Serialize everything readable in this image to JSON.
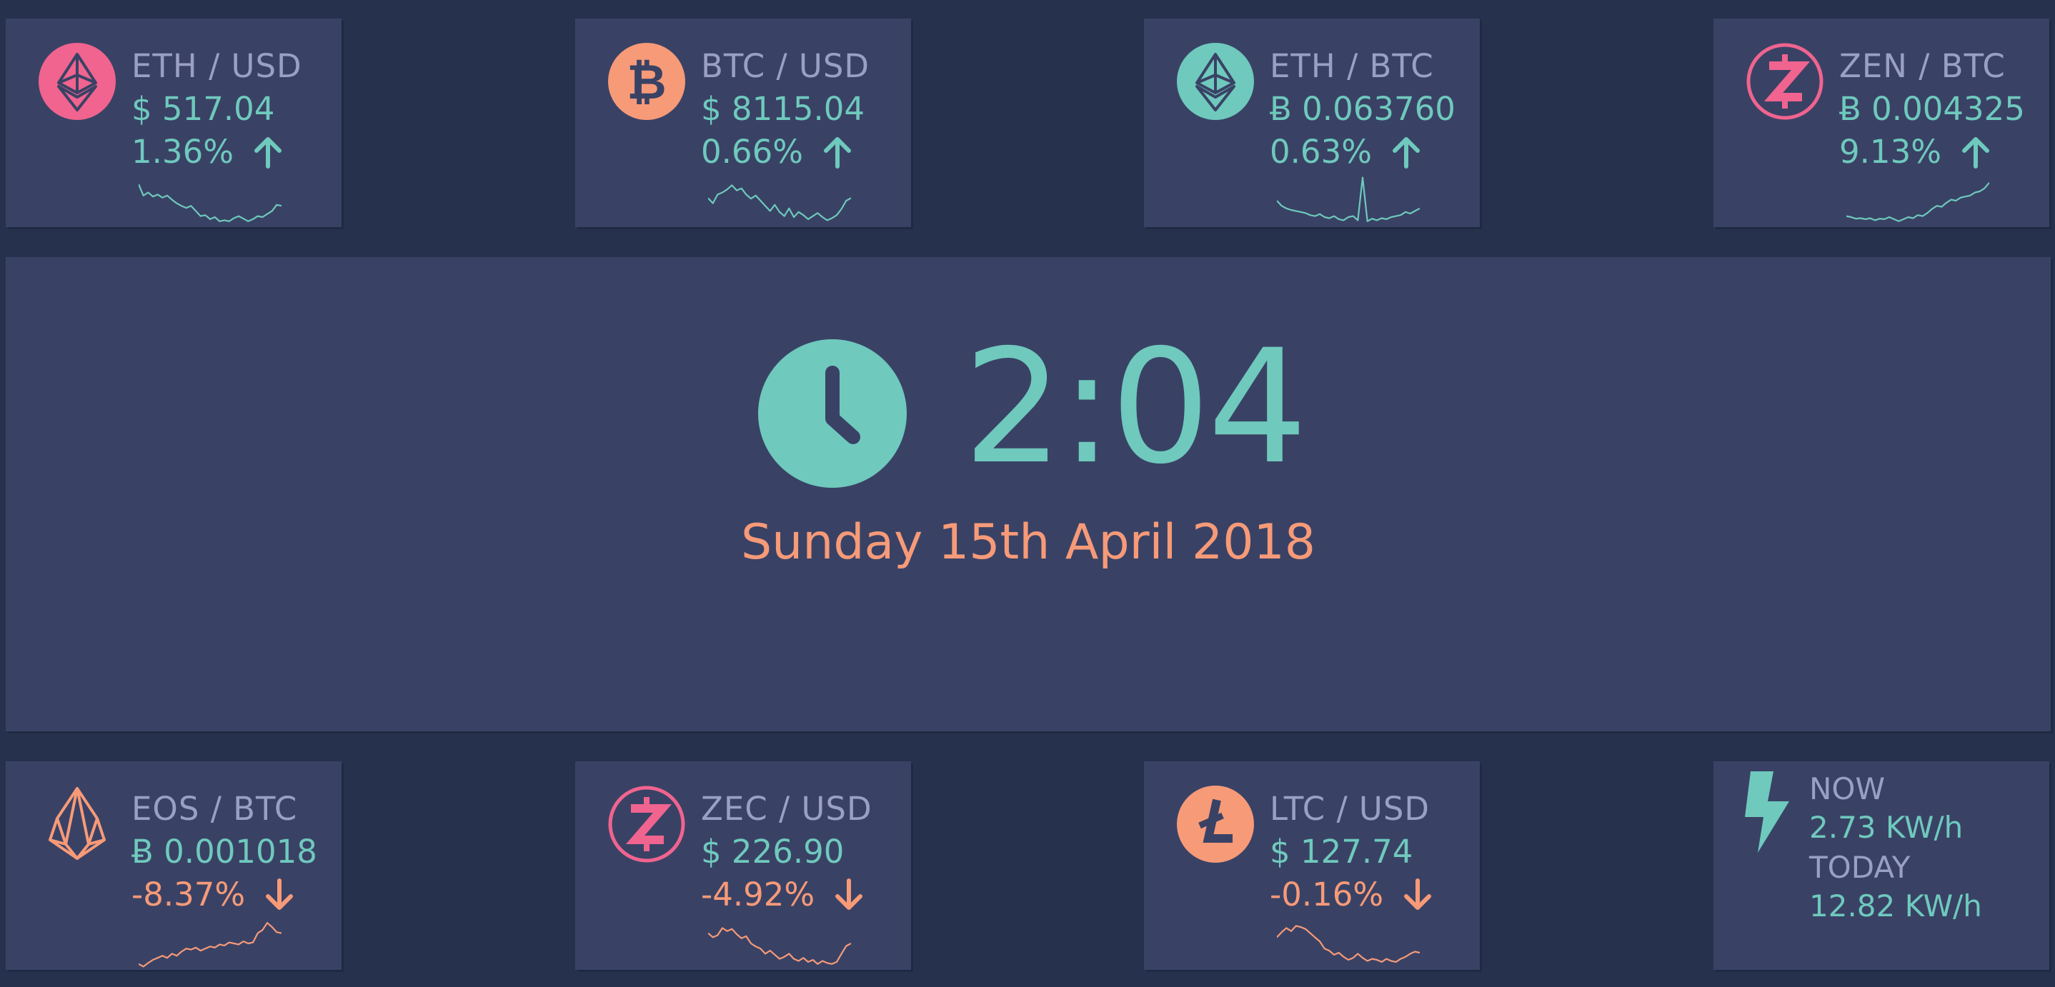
{
  "tickers": [
    {
      "pair": "ETH / USD",
      "price": "$ 517.04",
      "change": "1.36%",
      "direction": "up",
      "icon": "ethereum-icon",
      "icon_color": "#f0648f",
      "sparkline": [
        0.82,
        0.6,
        0.66,
        0.58,
        0.62,
        0.56,
        0.6,
        0.52,
        0.45,
        0.4,
        0.36,
        0.4,
        0.3,
        0.2,
        0.22,
        0.14,
        0.18,
        0.1,
        0.12,
        0.1,
        0.16,
        0.2,
        0.15,
        0.1,
        0.14,
        0.2,
        0.18,
        0.24,
        0.3,
        0.42,
        0.4
      ]
    },
    {
      "pair": "BTC / USD",
      "price": "$ 8115.04",
      "change": "0.66%",
      "direction": "up",
      "icon": "bitcoin-icon",
      "icon_color": "#f79a78",
      "sparkline": [
        0.55,
        0.45,
        0.62,
        0.66,
        0.72,
        0.8,
        0.7,
        0.74,
        0.62,
        0.54,
        0.6,
        0.5,
        0.4,
        0.3,
        0.42,
        0.28,
        0.2,
        0.35,
        0.18,
        0.28,
        0.22,
        0.14,
        0.2,
        0.26,
        0.18,
        0.12,
        0.16,
        0.22,
        0.34,
        0.5,
        0.55
      ]
    },
    {
      "pair": "ETH / BTC",
      "price": "Ƀ 0.063760",
      "change": "0.63%",
      "direction": "up",
      "icon": "ethereum-icon",
      "icon_color": "#6fc9bd",
      "sparkline": [
        0.5,
        0.4,
        0.35,
        0.32,
        0.3,
        0.28,
        0.26,
        0.22,
        0.2,
        0.24,
        0.18,
        0.16,
        0.2,
        0.14,
        0.12,
        0.18,
        0.2,
        0.12,
        0.95,
        0.1,
        0.15,
        0.12,
        0.16,
        0.14,
        0.18,
        0.2,
        0.22,
        0.28,
        0.25,
        0.3,
        0.35
      ]
    },
    {
      "pair": "ZEN / BTC",
      "price": "Ƀ 0.004325",
      "change": "9.13%",
      "direction": "up",
      "icon": "zen-icon",
      "icon_color": "#f0648f",
      "sparkline": [
        0.2,
        0.18,
        0.15,
        0.16,
        0.14,
        0.16,
        0.12,
        0.15,
        0.14,
        0.18,
        0.14,
        0.1,
        0.14,
        0.18,
        0.16,
        0.22,
        0.2,
        0.26,
        0.34,
        0.4,
        0.38,
        0.46,
        0.52,
        0.5,
        0.56,
        0.58,
        0.6,
        0.66,
        0.68,
        0.74,
        0.85
      ]
    },
    {
      "pair": "EOS / BTC",
      "price": "Ƀ 0.001018",
      "change": "-8.37%",
      "direction": "down",
      "icon": "eos-icon",
      "icon_color": "#f79a78",
      "sparkline": [
        0.1,
        0.05,
        0.12,
        0.18,
        0.22,
        0.26,
        0.22,
        0.3,
        0.26,
        0.34,
        0.4,
        0.38,
        0.42,
        0.36,
        0.4,
        0.44,
        0.42,
        0.48,
        0.46,
        0.52,
        0.5,
        0.48,
        0.54,
        0.5,
        0.52,
        0.7,
        0.76,
        0.9,
        0.82,
        0.72,
        0.7
      ]
    },
    {
      "pair": "ZEC / USD",
      "price": "$ 226.90",
      "change": "-4.92%",
      "direction": "down",
      "icon": "zcash-icon",
      "icon_color": "#f0648f",
      "sparkline": [
        0.7,
        0.62,
        0.66,
        0.8,
        0.74,
        0.78,
        0.68,
        0.6,
        0.64,
        0.5,
        0.44,
        0.4,
        0.3,
        0.36,
        0.28,
        0.2,
        0.24,
        0.3,
        0.2,
        0.16,
        0.22,
        0.14,
        0.18,
        0.1,
        0.16,
        0.12,
        0.1,
        0.14,
        0.3,
        0.45,
        0.5
      ]
    },
    {
      "pair": "LTC / USD",
      "price": "$ 127.74",
      "change": "-0.16%",
      "direction": "down",
      "icon": "litecoin-icon",
      "icon_color": "#f79a78",
      "sparkline": [
        0.62,
        0.72,
        0.8,
        0.74,
        0.84,
        0.82,
        0.78,
        0.7,
        0.62,
        0.54,
        0.4,
        0.36,
        0.28,
        0.32,
        0.24,
        0.18,
        0.22,
        0.3,
        0.22,
        0.16,
        0.2,
        0.18,
        0.14,
        0.2,
        0.16,
        0.14,
        0.2,
        0.24,
        0.3,
        0.34,
        0.32
      ]
    }
  ],
  "clock": {
    "time": "2:04",
    "date": "Sunday 15th April 2018",
    "icon": "clock-icon"
  },
  "power": {
    "icon": "lightning-icon",
    "now_label": "NOW",
    "now_value": "2.73 KW/h",
    "today_label": "TODAY",
    "today_value": "12.82 KW/h"
  },
  "colors": {
    "background": "#26324d",
    "card": "#394265",
    "up": "#6fc9bd",
    "down": "#f79a78",
    "label": "#9aa0c4",
    "pink": "#f0648f"
  }
}
